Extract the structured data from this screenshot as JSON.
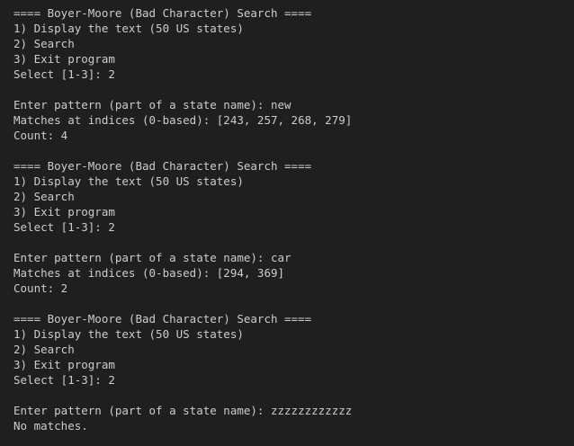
{
  "terminal": {
    "lines": [
      "==== Boyer-Moore (Bad Character) Search ====",
      "1) Display the text (50 US states)",
      "2) Search",
      "3) Exit program",
      "Select [1-3]: 2",
      "",
      "Enter pattern (part of a state name): new",
      "Matches at indices (0-based): [243, 257, 268, 279]",
      "Count: 4",
      "",
      "==== Boyer-Moore (Bad Character) Search ====",
      "1) Display the text (50 US states)",
      "2) Search",
      "3) Exit program",
      "Select [1-3]: 2",
      "",
      "Enter pattern (part of a state name): car",
      "Matches at indices (0-based): [294, 369]",
      "Count: 2",
      "",
      "==== Boyer-Moore (Bad Character) Search ====",
      "1) Display the text (50 US states)",
      "2) Search",
      "3) Exit program",
      "Select [1-3]: 2",
      "",
      "Enter pattern (part of a state name): zzzzzzzzzzzz",
      "No matches."
    ]
  }
}
